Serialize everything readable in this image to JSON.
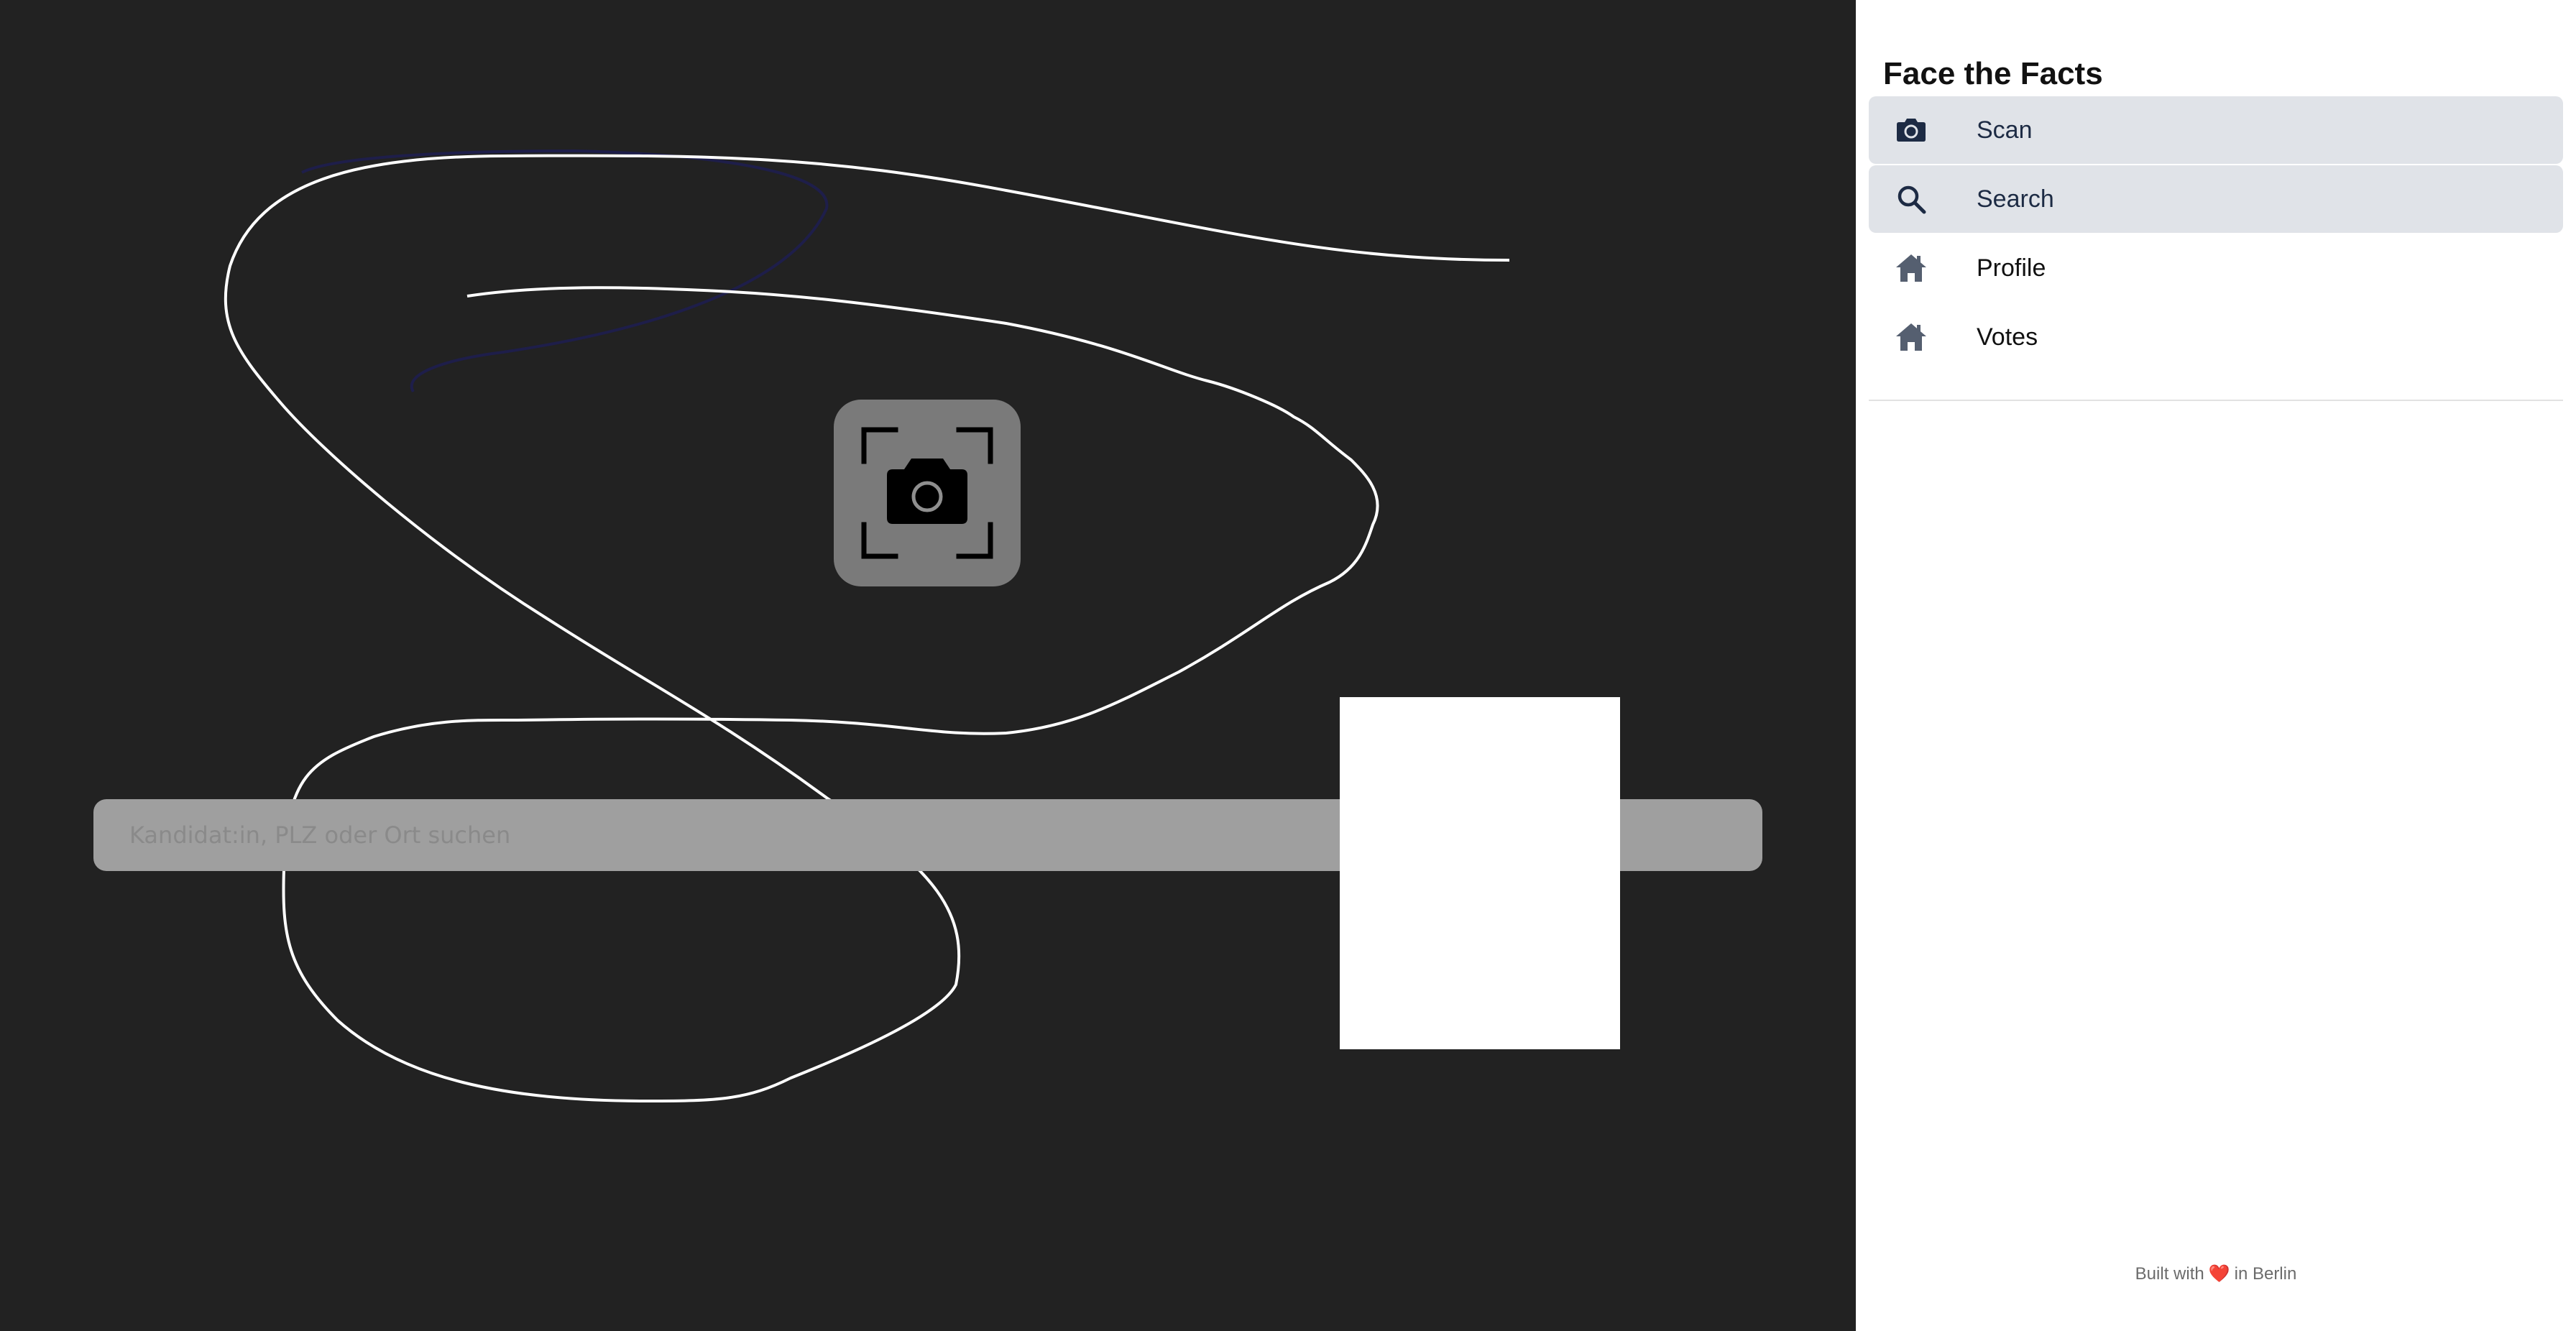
{
  "sidebar": {
    "title": "Face the Facts",
    "nav": [
      {
        "label": "Scan",
        "icon": "camera-icon",
        "active": true
      },
      {
        "label": "Search",
        "icon": "search-icon",
        "active": true
      },
      {
        "label": "Profile",
        "icon": "home-icon",
        "active": false
      },
      {
        "label": "Votes",
        "icon": "home-icon",
        "active": false
      }
    ],
    "footer": {
      "prefix": "Built with",
      "heart": "❤️",
      "suffix": "in Berlin"
    }
  },
  "main": {
    "scan_icon": "camera-scan-icon",
    "search": {
      "placeholder": "Kandidat:in, PLZ oder Ort suchen",
      "value": ""
    }
  },
  "colors": {
    "background": "#222222",
    "sidebar": "#ffffff",
    "active_item": "#e0e3e8",
    "scan_button": "#7a7a7a",
    "search_bar": "#9f9f9f"
  }
}
